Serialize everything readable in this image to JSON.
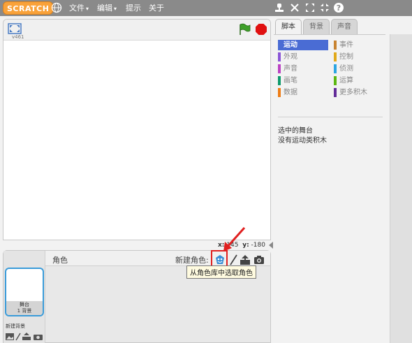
{
  "menubar": {
    "logo": "SCRATCH",
    "file": "文件",
    "edit": "编辑",
    "tips": "提示",
    "about": "关于",
    "caret": "▾"
  },
  "stage": {
    "version": "v461",
    "coords": {
      "x_label": "x:",
      "x_value": "145",
      "y_label": "y:",
      "y_value": "-180"
    }
  },
  "sprite_pane": {
    "label": "角色",
    "new_sprite_label": "新建角色:",
    "tooltip": "从角色库中选取角色",
    "stage_thumb_name": "舞台",
    "stage_thumb_count": "1 背景",
    "new_backdrop_label": "新建背景"
  },
  "right_panel": {
    "tabs": [
      "脚本",
      "背景",
      "声音"
    ],
    "categories": [
      {
        "label": "运动",
        "color": "#4a6cd4"
      },
      {
        "label": "外观",
        "color": "#8a55d7"
      },
      {
        "label": "声音",
        "color": "#bb42c3"
      },
      {
        "label": "画笔",
        "color": "#0e9a6c"
      },
      {
        "label": "数据",
        "color": "#ee7d16"
      },
      {
        "label": "事件",
        "color": "#c88330"
      },
      {
        "label": "控制",
        "color": "#e1a91a"
      },
      {
        "label": "侦测",
        "color": "#2ca5e2"
      },
      {
        "label": "运算",
        "color": "#5cb712"
      },
      {
        "label": "更多积木",
        "color": "#632d99"
      }
    ],
    "message_1": "选中的舞台",
    "message_2": "没有运动类积木"
  },
  "colors": {
    "topbar": "#8a8a8a",
    "accent_blue": "#3a9bd9",
    "highlight_red": "#e02020"
  }
}
